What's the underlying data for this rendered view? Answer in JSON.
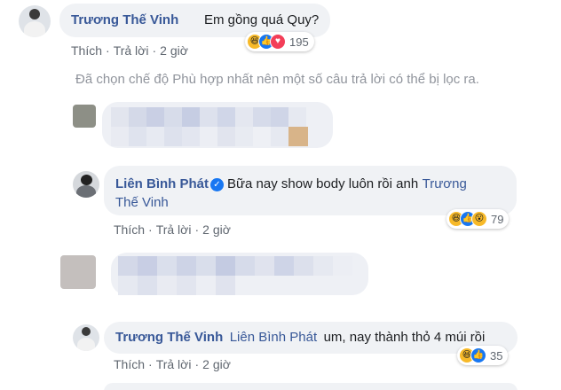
{
  "comment1": {
    "author": "Trương Thế Vinh",
    "text": "Em gồng quá Quy?",
    "actions": {
      "like": "Thích",
      "reply": "Trả lời",
      "time": "2 giờ"
    },
    "reactions": {
      "icons": [
        "haha-icon",
        "like-icon",
        "love-icon"
      ],
      "count": "195"
    }
  },
  "filter_notice": "Đã chọn chế độ Phù hợp nhất nên một số câu trả lời có thể bị lọc ra.",
  "reply1": {
    "author": "Liên Bình Phát",
    "text": "Bữa nay show body luôn rồi anh",
    "mention_line1": "Trương",
    "mention_line2": "Thế Vinh",
    "actions": {
      "like": "Thích",
      "reply": "Trả lời",
      "time": "2 giờ"
    },
    "reactions": {
      "icons": [
        "haha-icon",
        "like-icon",
        "wow-icon"
      ],
      "count": "79"
    }
  },
  "reply2": {
    "author": "Trương Thế Vinh",
    "mention": "Liên Bình Phát",
    "text": "um, nay thành thỏ 4 múi rồi",
    "actions": {
      "like": "Thích",
      "reply": "Trả lời",
      "time": "2 giờ"
    },
    "reactions": {
      "icons": [
        "haha-icon",
        "like-icon"
      ],
      "count": "35"
    }
  },
  "colors": {
    "link": "#385898",
    "bubble": "#f0f2f5",
    "meta": "#606770",
    "notice": "#90949c"
  }
}
